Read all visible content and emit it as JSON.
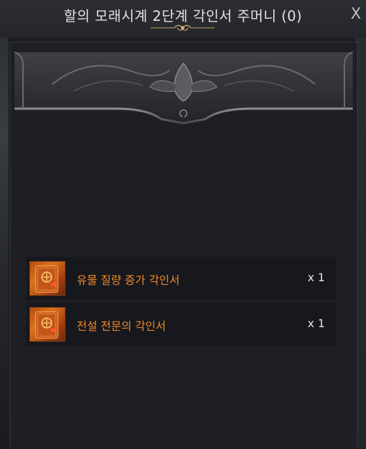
{
  "window": {
    "title": "할의 모래시계 2단계 각인서 주머니 (0)",
    "close_label": "X"
  },
  "items": [
    {
      "name": "유물 질량 증가 각인서",
      "quantity": "x 1",
      "icon": "engraving-book-icon",
      "rarity_color": "#f08a2a"
    },
    {
      "name": "전설 전문의 각인서",
      "quantity": "x 1",
      "icon": "engraving-book-icon",
      "rarity_color": "#f08a2a"
    }
  ]
}
